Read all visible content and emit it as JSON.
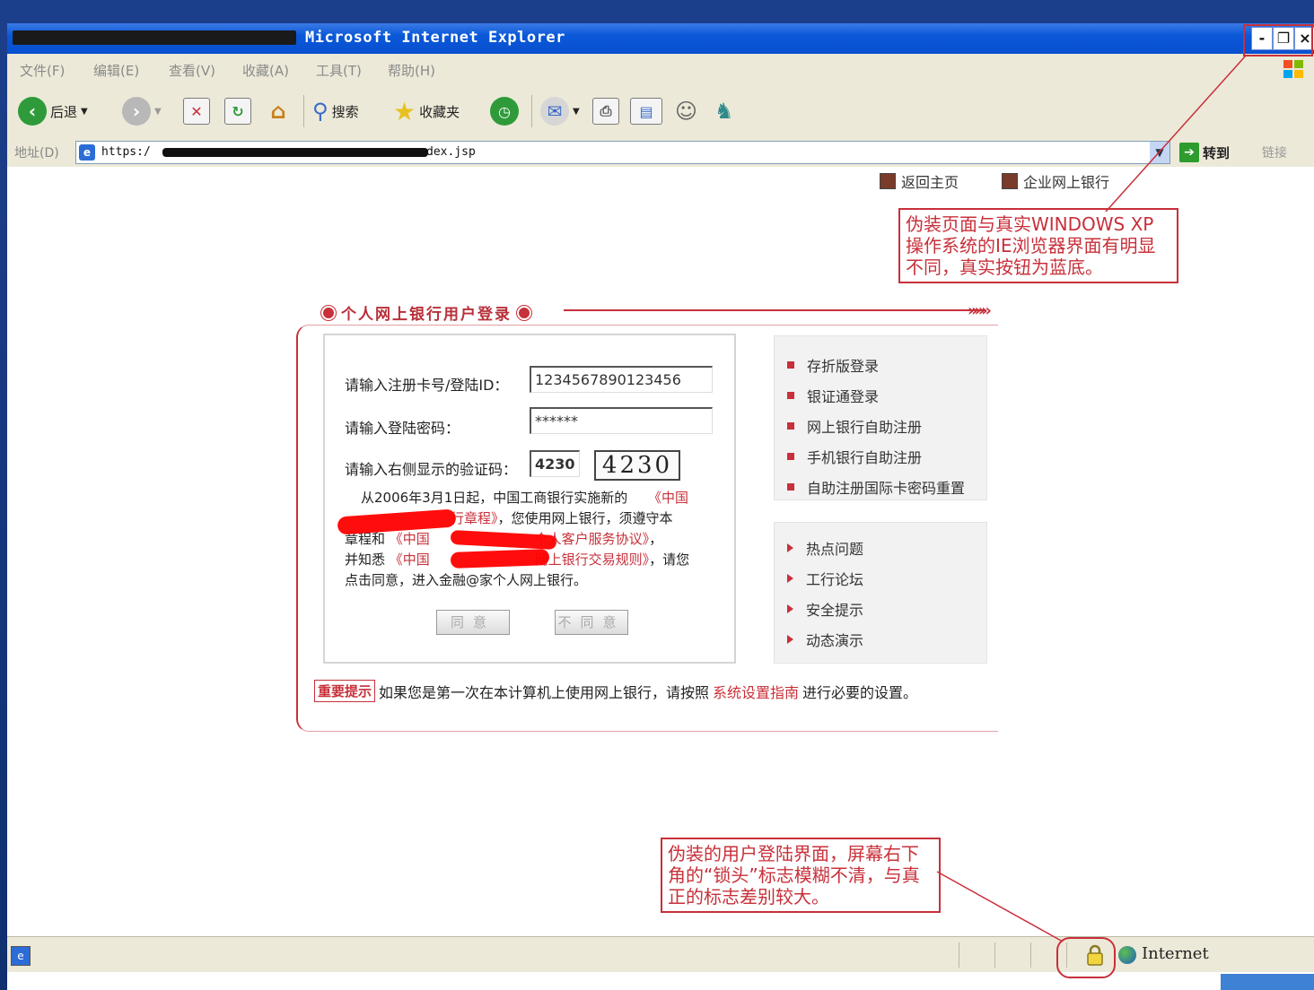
{
  "window": {
    "title": "Microsoft Internet Explorer",
    "controls": {
      "minimize": "-",
      "restore": "❐",
      "close": "×"
    }
  },
  "menu": [
    "文件(F)",
    "编辑(E)",
    "查看(V)",
    "收藏(A)",
    "工具(T)",
    "帮助(H)"
  ],
  "toolbar": {
    "back_label": "后退",
    "search_label": "搜索",
    "favorites_label": "收藏夹"
  },
  "address": {
    "label": "地址(D)",
    "url_prefix": "https:/",
    "url_suffix": "dex.jsp",
    "go_label": "转到",
    "links_label": "链接"
  },
  "page": {
    "top_links": [
      "返回主页",
      "企业网上银行"
    ],
    "annotation_top": "伪装页面与真实WINDOWS XP操作系统的IE浏览器界面有明显不同，真实按钮为蓝底。",
    "login_title": "个人网上银行用户登录",
    "form": {
      "card_label": "请输入注册卡号/登陆ID：",
      "card_value": "1234567890123456",
      "password_label": "请输入登陆密码：",
      "password_value": "******",
      "captcha_label": "请输入右侧显示的验证码：",
      "captcha_input": "4230",
      "captcha_image": "4230",
      "agree_button": "同意",
      "disagree_button": "不同意"
    },
    "agreement": {
      "line1_start": "从2006年3月1日起，中国工商银行实施新的",
      "line1_link": "《中国",
      "line2_link": "行章程》",
      "line2_text": "，您使用网上银行，须遵守本",
      "line3_text": "章程和",
      "line3_link1": "《中国",
      "line3_link2": "个人客户服务协议》",
      "line3_end": "，",
      "line4_text": "并知悉",
      "line4_link1": "《中国",
      "line4_link2": "网上银行交易规则》",
      "line4_end": "，请您",
      "line5_text": "点击同意，进入金融@家个人网上银行。"
    },
    "side_menu_1": [
      "存折版登录",
      "银证通登录",
      "网上银行自助注册",
      "手机银行自助注册",
      "自助注册国际卡密码重置"
    ],
    "side_menu_2": [
      "热点问题",
      "工行论坛",
      "安全提示",
      "动态演示"
    ],
    "notice": {
      "badge": "重要提示",
      "text_before": "如果您是第一次在本计算机上使用网上银行，请按照",
      "link": "系统设置指南",
      "text_after": "进行必要的设置。"
    },
    "annotation_bottom": "伪装的用户登陆界面，屏幕右下角的“锁头”标志模糊不清，与真正的标志差别较大。"
  },
  "status": {
    "zone": "Internet"
  },
  "colors": {
    "accent_red": "#c8303a",
    "titlebar_blue": "#0a58d8",
    "xp_chrome": "#ece9d8"
  }
}
